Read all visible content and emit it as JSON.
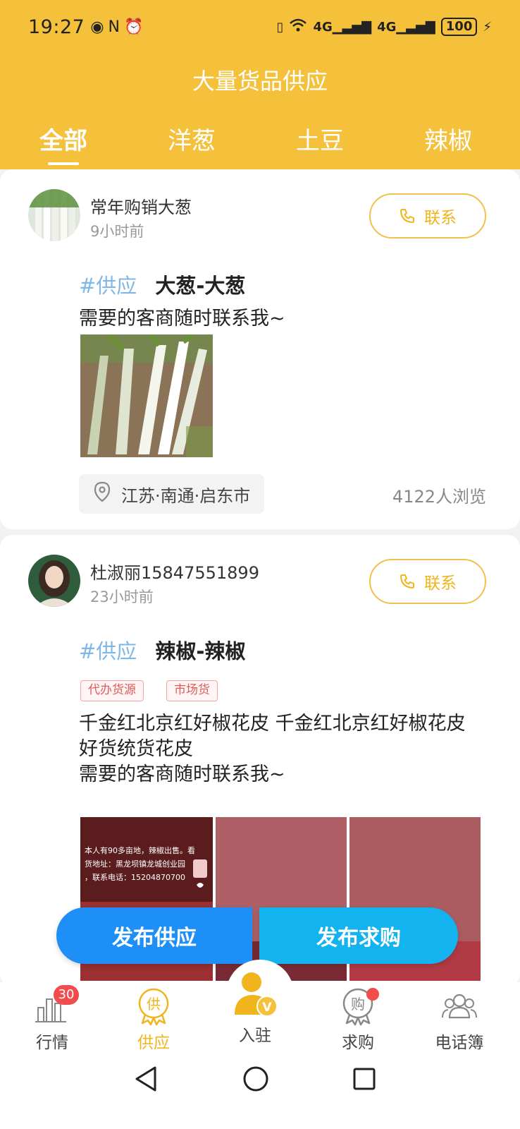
{
  "status_bar": {
    "time": "19:27",
    "battery": "100"
  },
  "header": {
    "title": "大量货品供应",
    "tabs": [
      {
        "label": "全部",
        "active": true
      },
      {
        "label": "洋葱",
        "active": false
      },
      {
        "label": "土豆",
        "active": false
      },
      {
        "label": "辣椒",
        "active": false
      }
    ]
  },
  "posts": [
    {
      "user": "常年购销大葱",
      "time": "9小时前",
      "contact_label": "联系",
      "tag": "#供应",
      "title": "大葱-大葱",
      "description": "需要的客商随时联系我~",
      "location": "江苏·南通·启东市",
      "views": "4122人浏览"
    },
    {
      "user": "杜淑丽15847551899",
      "time": "23小时前",
      "contact_label": "联系",
      "tag": "#供应",
      "title": "辣椒-辣椒",
      "badges": [
        "代办货源",
        "市场货"
      ],
      "description_lines": [
        "千金红北京红好椒花皮 千金红北京红好椒花皮",
        "好货统货花皮",
        "需要的客商随时联系我~"
      ],
      "image_overlay_text": [
        "本人有90多亩地，辣椒出售。看",
        "货地址：黑龙坝镇龙城创业园",
        "，联系电话：15204870700"
      ]
    }
  ],
  "actions": {
    "publish_supply": "发布供应",
    "publish_demand": "发布求购"
  },
  "bottom_nav": {
    "items": [
      {
        "label": "行情",
        "badge": "30"
      },
      {
        "label": "供应",
        "active": true
      },
      {
        "label": "入驻"
      },
      {
        "label": "求购",
        "dot": true
      },
      {
        "label": "电话簿"
      }
    ]
  },
  "colors": {
    "brand": "#f5c03a",
    "accent": "#f0b51c",
    "tag": "#7fb8e8",
    "fab_left": "#1e8ff7",
    "fab_right": "#12b3ee",
    "badge": "#f24c4c"
  }
}
